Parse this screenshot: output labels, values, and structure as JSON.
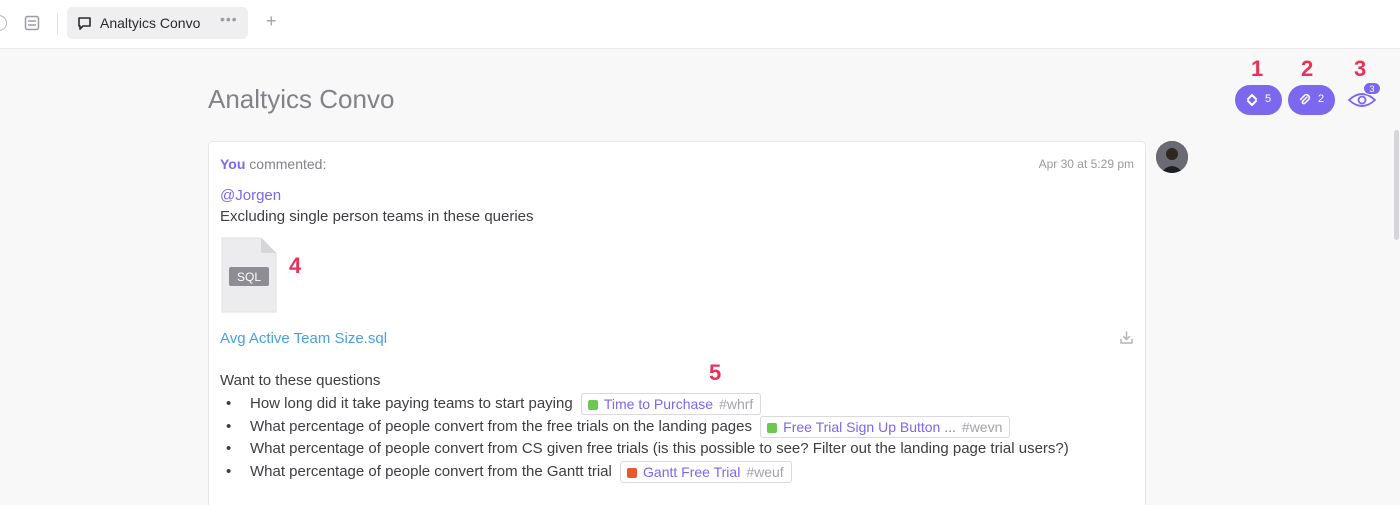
{
  "tabs": {
    "active_label": "Analtyics Convo",
    "more_label": "•••",
    "add_label": "+"
  },
  "page": {
    "title": "Analtyics Convo"
  },
  "actions": {
    "subtasks_count": "5",
    "attachments_count": "2",
    "watchers_count": "3",
    "accent_color": "#7b68ee"
  },
  "callouts": [
    "1",
    "2",
    "3",
    "4",
    "5"
  ],
  "comment": {
    "author": "You",
    "verb": "commented:",
    "timestamp": "Apr 30 at 5:29 pm",
    "mention": "@Jorgen",
    "text": "Excluding single person teams in these queries",
    "attachment": {
      "type_label": "SQL",
      "filename": "Avg Active Team Size.sql"
    },
    "questions_intro": "Want to these questions",
    "questions": [
      {
        "text": "How long did it take paying teams to start paying",
        "task": {
          "name": "Time to Purchase",
          "id": "#whrf",
          "color": "#6bc950"
        }
      },
      {
        "text": "What percentage of people convert from the free trials on the landing pages",
        "task": {
          "name": "Free Trial Sign Up Button ...",
          "id": "#wevn",
          "color": "#6bc950"
        }
      },
      {
        "text": "What percentage of people convert from CS given free trials (is this possible to see? Filter out the landing page trial users?)",
        "task": null
      },
      {
        "text": "What percentage of people convert from the Gantt trial",
        "task": {
          "name": "Gantt Free Trial",
          "id": "#weuf",
          "color": "#e8582c"
        }
      }
    ]
  }
}
